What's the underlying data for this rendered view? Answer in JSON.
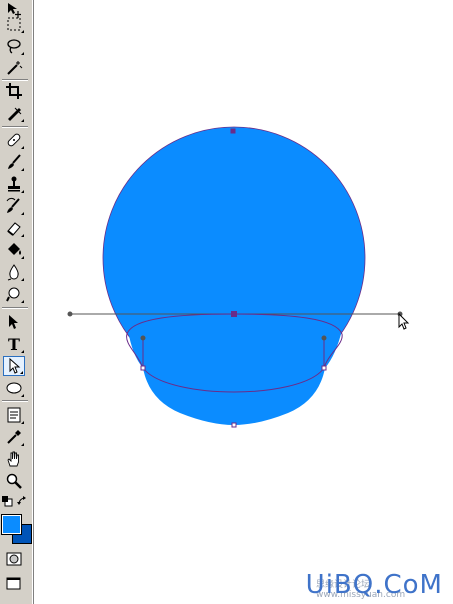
{
  "toolbar": {
    "tools": [
      {
        "name": "move-tool",
        "icon": "move-icon"
      },
      {
        "name": "marquee-tool",
        "icon": "marquee-icon"
      },
      {
        "name": "lasso-tool",
        "icon": "lasso-icon"
      },
      {
        "name": "magic-wand-tool",
        "icon": "magic-wand-icon"
      },
      {
        "name": "crop-tool",
        "icon": "crop-icon"
      },
      {
        "name": "slice-tool",
        "icon": "slice-icon"
      },
      {
        "name": "healing-brush-tool",
        "icon": "bandage-icon"
      },
      {
        "name": "brush-tool",
        "icon": "brush-icon"
      },
      {
        "name": "clone-stamp-tool",
        "icon": "stamp-icon"
      },
      {
        "name": "history-brush-tool",
        "icon": "history-brush-icon"
      },
      {
        "name": "eraser-tool",
        "icon": "eraser-icon"
      },
      {
        "name": "paint-bucket-tool",
        "icon": "bucket-icon"
      },
      {
        "name": "blur-tool",
        "icon": "drop-icon"
      },
      {
        "name": "dodge-tool",
        "icon": "dodge-icon"
      },
      {
        "name": "path-selection-tool",
        "icon": "path-select-icon"
      },
      {
        "name": "type-tool",
        "icon": "type-icon",
        "label": "T"
      },
      {
        "name": "direct-selection-tool",
        "icon": "direct-select-icon",
        "active": true
      },
      {
        "name": "ellipse-tool",
        "icon": "ellipse-icon"
      },
      {
        "name": "notes-tool",
        "icon": "notes-icon"
      },
      {
        "name": "eyedropper-tool",
        "icon": "eyedropper-icon"
      },
      {
        "name": "hand-tool",
        "icon": "hand-icon"
      },
      {
        "name": "zoom-tool",
        "icon": "zoom-icon"
      }
    ],
    "foreground_color": "#0b8cff",
    "background_color": "#0054b8"
  },
  "canvas": {
    "shape_fill": "#0b8cff",
    "path_color": "#6a2c8a"
  },
  "watermark": {
    "text": "UiBQ.CoM",
    "subtext": "思缘设计论坛 www.missyuan.com"
  }
}
